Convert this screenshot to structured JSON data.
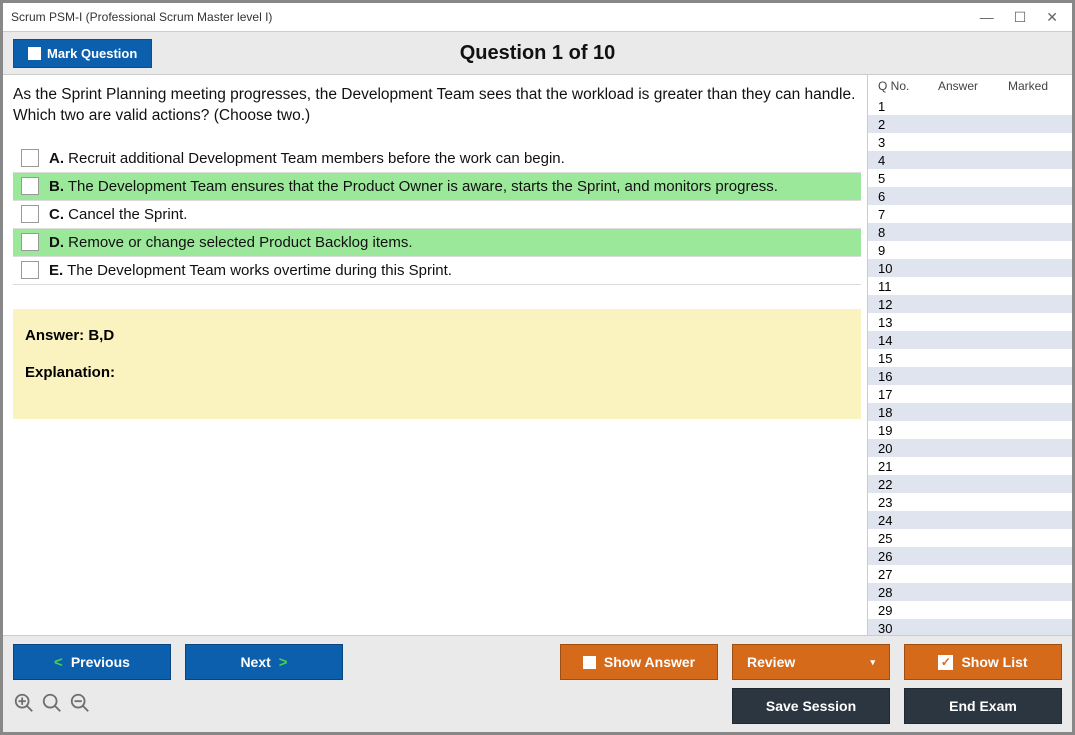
{
  "window": {
    "title": "Scrum PSM-I (Professional Scrum Master level I)"
  },
  "header": {
    "mark_label": "Mark Question",
    "question_title": "Question 1 of 10"
  },
  "question": {
    "text": "As the Sprint Planning meeting progresses, the Development Team sees that the workload is greater than they can handle. Which two are valid actions? (Choose two.)",
    "options": [
      {
        "letter": "A.",
        "text": "Recruit additional Development Team members before the work can begin.",
        "correct": false
      },
      {
        "letter": "B.",
        "text": "The Development Team ensures that the Product Owner is aware, starts the Sprint, and monitors progress.",
        "correct": true
      },
      {
        "letter": "C.",
        "text": "Cancel the Sprint.",
        "correct": false
      },
      {
        "letter": "D.",
        "text": "Remove or change selected Product Backlog items.",
        "correct": true
      },
      {
        "letter": "E.",
        "text": "The Development Team works overtime during this Sprint.",
        "correct": false
      }
    ],
    "answer_label": "Answer: B,D",
    "explanation_label": "Explanation:"
  },
  "sidebar": {
    "col_qno": "Q No.",
    "col_answer": "Answer",
    "col_marked": "Marked",
    "rows": 30
  },
  "footer": {
    "previous": "Previous",
    "next": "Next",
    "show_answer": "Show Answer",
    "review": "Review",
    "show_list": "Show List",
    "save_session": "Save Session",
    "end_exam": "End Exam"
  }
}
